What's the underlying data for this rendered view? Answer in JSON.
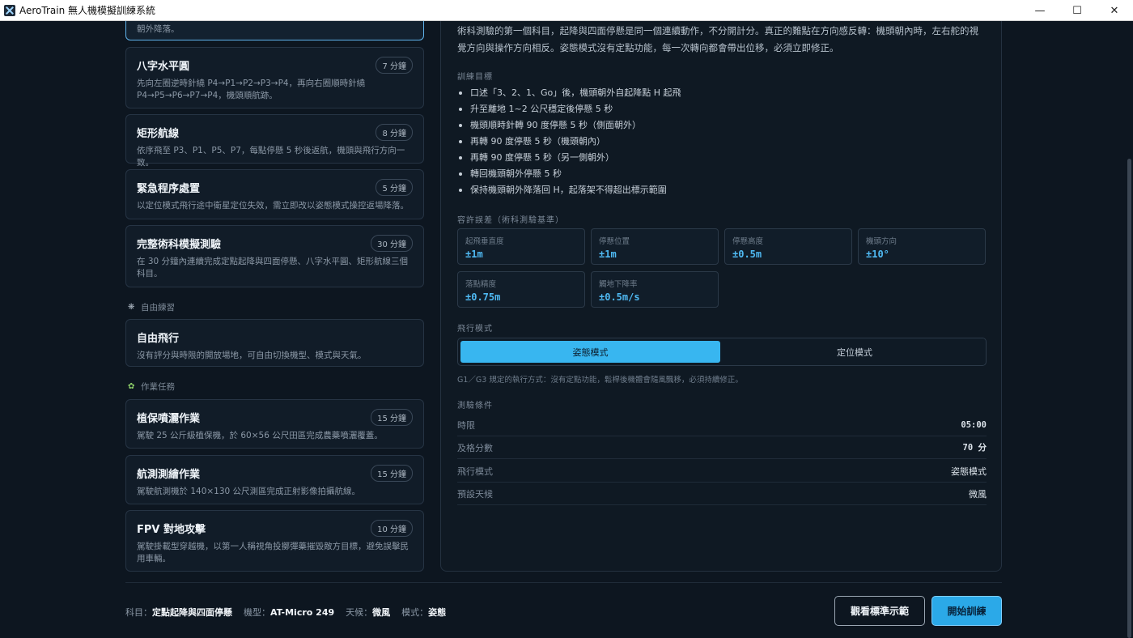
{
  "window": {
    "title": "AeroTrain 無人機模擬訓練系統",
    "min_icon": "minimize-icon",
    "max_icon": "maximize-icon",
    "close_icon": "close-icon"
  },
  "lessons": {
    "active_partial_desc": "朝外降落。",
    "items": [
      {
        "title": "八字水平圓",
        "duration": "7 分鐘",
        "desc": "先向左圈逆時針繞 P4→P1→P2→P3→P4，再向右圈順時針繞 P4→P5→P6→P7→P4，機頭順航跡。"
      },
      {
        "title": "矩形航線",
        "duration": "8 分鐘",
        "desc": "依序飛至 P3、P1、P5、P7，每點停懸 5 秒後返航，機頭與飛行方向一致。"
      },
      {
        "title": "緊急程序處置",
        "duration": "5 分鐘",
        "desc": "以定位模式飛行途中衛星定位失效，需立即改以姿態模式操控返場降落。"
      },
      {
        "title": "完整術科模擬測驗",
        "duration": "30 分鐘",
        "desc": "在 30 分鐘內連續完成定點起降與四面停懸、八字水平圓、矩形航線三個科目。"
      }
    ],
    "free_section": "自由練習",
    "free_items": [
      {
        "title": "自由飛行",
        "desc": "沒有評分與時限的開放場地，可自由切換機型、模式與天氣。"
      }
    ],
    "mission_section": "作業任務",
    "mission_items": [
      {
        "title": "植保噴灑作業",
        "duration": "15 分鐘",
        "desc": "駕駛 25 公斤級植保機，於 60×56 公尺田區完成農藥噴灑覆蓋。"
      },
      {
        "title": "航測測繪作業",
        "duration": "15 分鐘",
        "desc": "駕駛航測機於 140×130 公尺測區完成正射影像拍攝航線。"
      },
      {
        "title": "FPV 對地攻擊",
        "duration": "10 分鐘",
        "desc": "駕駛掛載型穿越機，以第一人稱視角投擲彈藥摧毀敵方目標，避免誤擊民用車輛。"
      }
    ]
  },
  "detail": {
    "intro": "術科測驗的第一個科目，起降與四面停懸是同一個連續動作，不分開計分。真正的難點在方向感反轉：機頭朝內時，左右舵的視覺方向與操作方向相反。姿態模式沒有定點功能，每一次轉向都會帶出位移，必須立即修正。",
    "goals_head": "訓練目標",
    "goals": [
      "口述「3、2、1、Go」後，機頭朝外自起降點 H 起飛",
      "升至離地 1~2 公尺穩定後停懸 5 秒",
      "機頭順時針轉 90 度停懸 5 秒（側面朝外）",
      "再轉 90 度停懸 5 秒（機頭朝內）",
      "再轉 90 度停懸 5 秒（另一側朝外）",
      "轉回機頭朝外停懸 5 秒",
      "保持機頭朝外降落回 H，起落架不得超出標示範圍"
    ],
    "tol_head": "容許誤差（術科測驗基準）",
    "tolerances": [
      {
        "label": "起飛垂直度",
        "value": "±1m"
      },
      {
        "label": "停懸位置",
        "value": "±1m"
      },
      {
        "label": "停懸高度",
        "value": "±0.5m"
      },
      {
        "label": "機頭方向",
        "value": "±10°"
      },
      {
        "label": "落點精度",
        "value": "±0.75m"
      },
      {
        "label": "觸地下降率",
        "value": "±0.5m/s"
      }
    ],
    "mode_head": "飛行模式",
    "mode_on": "姿態模式",
    "mode_off": "定位模式",
    "mode_note": "G1／G3 規定的執行方式：沒有定點功能，鬆桿後機體會隨風飄移，必須持續修正。",
    "cond_head": "測驗條件",
    "conditions": [
      {
        "k": "時限",
        "v": "05:00"
      },
      {
        "k": "及格分數",
        "v": "70 分"
      },
      {
        "k": "飛行模式",
        "v": "姿態模式"
      },
      {
        "k": "預設天候",
        "v": "微風"
      }
    ]
  },
  "footer": {
    "subject_label": "科目：",
    "subject": "定點起降與四面停懸",
    "model_label": "機型：",
    "model": "AT-Micro 249",
    "weather_label": "天候：",
    "weather": "微風",
    "mode_label": "模式：",
    "mode": "姿態",
    "demo_button": "觀看標準示範",
    "start_button": "開始訓練"
  },
  "colors": {
    "accent": "#38b6f0",
    "background": "#0d1620",
    "card": "#111c28"
  }
}
